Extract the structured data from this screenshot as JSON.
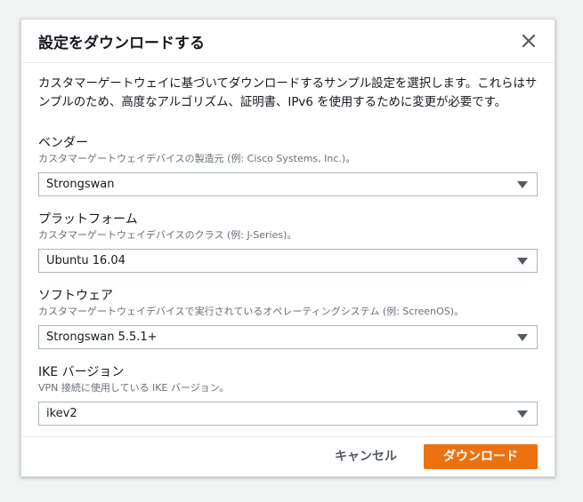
{
  "modal": {
    "title": "設定をダウンロードする",
    "description": "カスタマーゲートウェイに基づいてダウンロードするサンプル設定を選択します。これらはサンプルのため、高度なアルゴリズム、証明書、IPv6 を使用するために変更が必要です。"
  },
  "fields": {
    "vendor": {
      "label": "ベンダー",
      "help": "カスタマーゲートウェイデバイスの製造元 (例: Cisco Systems, Inc.)。",
      "value": "Strongswan"
    },
    "platform": {
      "label": "プラットフォーム",
      "help": "カスタマーゲートウェイデバイスのクラス (例: J-Series)。",
      "value": "Ubuntu 16.04"
    },
    "software": {
      "label": "ソフトウェア",
      "help": "カスタマーゲートウェイデバイスで実行されているオペレーティングシステム (例: ScreenOS)。",
      "value": "Strongswan 5.5.1+"
    },
    "ike": {
      "label": "IKE バージョン",
      "help": "VPN 接続に使用している IKE バージョン。",
      "value": "ikev2"
    }
  },
  "footer": {
    "cancel_label": "キャンセル",
    "download_label": "ダウンロード"
  },
  "colors": {
    "primary": "#ec7211",
    "border": "#aab7b8",
    "help_text": "#687078"
  },
  "icons": {
    "close": "close-icon",
    "caret": "caret-down-icon"
  }
}
